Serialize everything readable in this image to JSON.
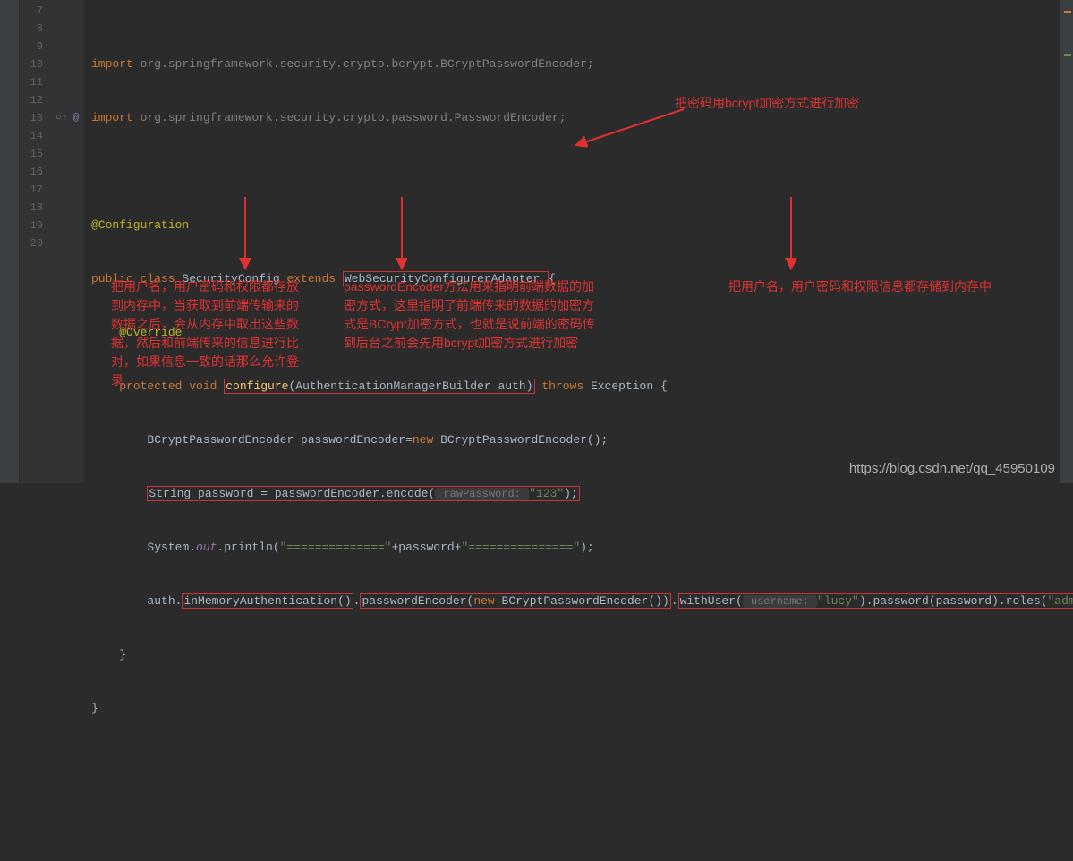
{
  "gutter": {
    "start": 7,
    "end": 20,
    "icons": {
      "13": "○↑ @"
    }
  },
  "code": {
    "l7": {
      "import_kw": "import",
      "pkg": " org.springframework.security.crypto.bcrypt.BCryptPasswordEncoder;"
    },
    "l8": {
      "import_kw": "import",
      "pkg": " org.springframework.security.crypto.password.PasswordEncoder;"
    },
    "l9": "",
    "l10": {
      "anno": "@Configuration"
    },
    "l11": {
      "pub": "public class ",
      "cls": "SecurityConfig ",
      "ext": "extends ",
      "sup": "WebSecurityConfigurerAdapter ",
      "brace": "{"
    },
    "l12": {
      "indent": "    ",
      "anno": "@Override"
    },
    "l13": {
      "indent": "    ",
      "prot": "protected void ",
      "mname": "configure",
      "sig": "(AuthenticationManagerBuilder auth)",
      "throws": " throws ",
      "exc": "Exception {"
    },
    "l14": {
      "indent": "        ",
      "t1": "BCryptPasswordEncoder passwordEncoder=",
      "new": "new ",
      "t2": "BCryptPasswordEncoder();"
    },
    "l15": {
      "indent": "        ",
      "t1": "String password = passwordEncoder.encode(",
      "hint": " rawPassword: ",
      "val": "\"123\"",
      "end": ");"
    },
    "l16": {
      "indent": "        ",
      "sys": "System.",
      "out": "out",
      "rest1": ".println(",
      "s1": "\"==============\"",
      "plus1": "+password+",
      "s2": "\"===============\"",
      "rest2": ");"
    },
    "l17": {
      "indent": "        ",
      "auth": "auth.",
      "m1": "inMemoryAuthentication()",
      "dot1": ".",
      "m2": "passwordEncoder(",
      "new": "new ",
      "enc": "BCryptPasswordEncoder())",
      "dot2": ".",
      "wu": "withUser(",
      "hint1": " username: ",
      "u": "\"lucy\"",
      "close_wu": ")",
      "pw": ".password(password).roles(",
      "role": "\"admin\"",
      "end": ");"
    },
    "l18": {
      "indent": "    ",
      "brace": "}"
    },
    "l19": "}",
    "l20": ""
  },
  "annotations": {
    "top_right": "把密码用bcrypt加密方式进行加密",
    "bottom_right": "把用户名，用户密码和权限信息都存储到内存中",
    "mid": "passwordEncoder方法用来指明前端数据的加密方式，这里指明了前端传来的数据的加密方式是BCrypt加密方式，也就是说前端的密码传到后台之前会先用bcrypt加密方式进行加密",
    "left": "把用户名，用户密码和权限都存放到内存中，当获取到前端传输来的数据之后，会从内存中取出这些数据，然后和前端传来的信息进行比对，如果信息一致的话那么允许登录"
  },
  "watermark": "https://blog.csdn.net/qq_45950109"
}
